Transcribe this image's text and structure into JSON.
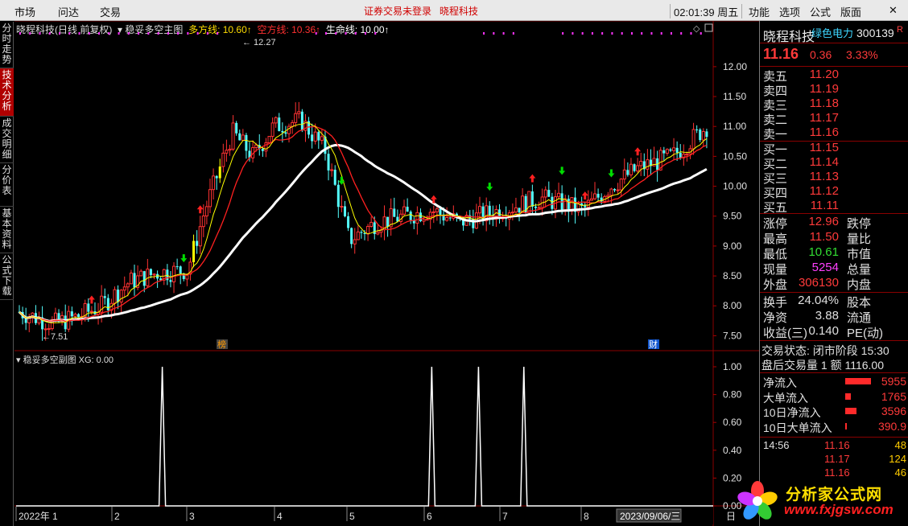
{
  "topbar": {
    "menu_left": [
      "市场",
      "问达",
      "交易"
    ],
    "center_notice": "证券交易未登录",
    "center_stock": "晓程科技",
    "clock": "02:01:39 周五",
    "menu_right": [
      "功能",
      "选项",
      "公式",
      "版面"
    ],
    "close_glyph": "✕"
  },
  "left_tabs": [
    "分时走势",
    "技术分析",
    "成交明细",
    "分价表",
    "基本资料",
    "公式下载"
  ],
  "main_legend": {
    "stock": "晓程科技(日线 前复权)",
    "indicator": "稳妥多空主图",
    "long_label": "多方线: 10.60↑",
    "short_label": "空方线: 10.36↑",
    "life_label": "生命线: 10.00↑"
  },
  "sub_legend": "稳妥多空副图 XG: 0.00",
  "chart_data": [
    {
      "type": "candlestick",
      "price_axis": [
        "12.00",
        "11.50",
        "11.00",
        "10.50",
        "10.00",
        "9.50",
        "9.00",
        "8.50",
        "8.00",
        "7.50"
      ],
      "ylim": [
        7.25,
        12.55
      ],
      "high_label": "12.27",
      "low_label": "7.51",
      "marker_rong": "榜",
      "marker_cai": "财",
      "x_ticks": [
        "2022年 1",
        "2",
        "3",
        "4",
        "5",
        "6",
        "7",
        "8"
      ],
      "date_cursor": "2023/09/06/三",
      "colors": {
        "up": "#ff3232",
        "down": "#54ffff",
        "long_line": "#ffff00",
        "short_line": "#ff2020",
        "life_line": "#ffffff",
        "buy_arrow": "#ff2020",
        "sell_arrow": "#00dd00"
      }
    },
    {
      "type": "line",
      "name": "XG",
      "yaxis": [
        "1.00",
        "0.80",
        "0.60",
        "0.40",
        "0.20",
        "0.00"
      ],
      "ylim": [
        0,
        1
      ],
      "spike_positions": [
        0.208,
        0.6,
        0.668,
        0.734
      ],
      "bottom_label": "日"
    }
  ],
  "quote": {
    "name": "晓程科技",
    "sector": "绿色电力",
    "code": "300139",
    "r_badge": "R",
    "price": "11.16",
    "change": "0.36",
    "pct": "3.33%",
    "asks": [
      {
        "label": "卖五",
        "price": "11.20"
      },
      {
        "label": "卖四",
        "price": "11.19"
      },
      {
        "label": "卖三",
        "price": "11.18"
      },
      {
        "label": "卖二",
        "price": "11.17"
      },
      {
        "label": "卖一",
        "price": "11.16"
      }
    ],
    "bids": [
      {
        "label": "买一",
        "price": "11.15"
      },
      {
        "label": "买二",
        "price": "11.14"
      },
      {
        "label": "买三",
        "price": "11.13"
      },
      {
        "label": "买四",
        "price": "11.12"
      },
      {
        "label": "买五",
        "price": "11.11"
      }
    ],
    "stats": [
      {
        "label": "涨停",
        "value": "12.96",
        "label2": "跌停"
      },
      {
        "label": "最高",
        "value": "11.50",
        "label2": "量比"
      },
      {
        "label": "最低",
        "value": "10.61",
        "label2": "市值"
      },
      {
        "label": "现量",
        "value": "5254",
        "label2": "总量"
      },
      {
        "label": "外盘",
        "value": "306130",
        "label2": "内盘"
      }
    ],
    "stats2": [
      {
        "label": "换手",
        "value": "24.04%",
        "label2": "股本"
      },
      {
        "label": "净资",
        "value": "3.88",
        "label2": "流通"
      },
      {
        "label": "收益(三)",
        "value": "0.140",
        "label2": "PE(动)"
      }
    ],
    "trade_status": "交易状态: 闭市阶段 15:30",
    "after_hours": "盘后交易量 1 额 1116.00",
    "flows": [
      {
        "label": "净流入",
        "value": "5955",
        "bar": 0.9
      },
      {
        "label": "大单流入",
        "value": "1765",
        "bar": 0.2
      },
      {
        "label": "10日净流入",
        "value": "3596",
        "bar": 0.4
      },
      {
        "label": "10日大单流入",
        "value": "390.9",
        "bar": 0.05
      }
    ],
    "ticks": [
      {
        "time": "14:56",
        "price": "11.16",
        "vol": "48"
      },
      {
        "time": "",
        "price": "11.17",
        "vol": "124"
      },
      {
        "time": "",
        "price": "11.16",
        "vol": "46"
      }
    ]
  },
  "watermark": {
    "title": "分析家公式网",
    "url": "www.fxjgsw.com"
  }
}
